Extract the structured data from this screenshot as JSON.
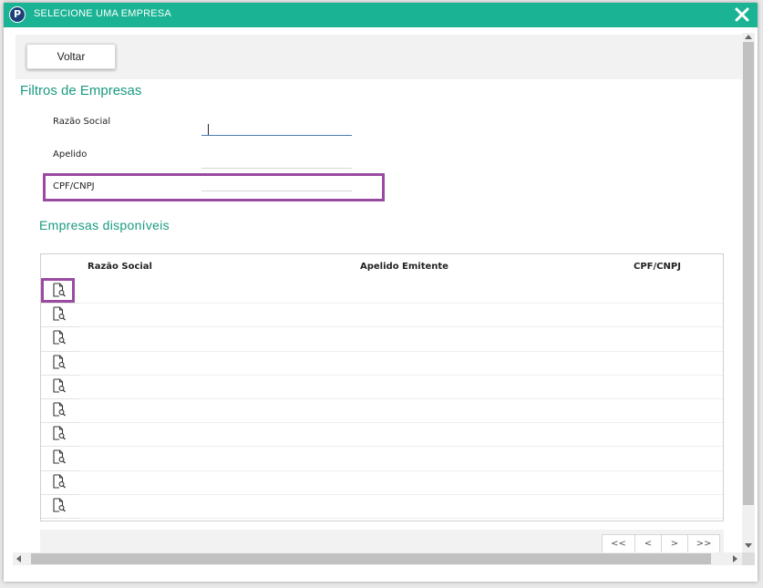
{
  "window": {
    "title": "SELECIONE UMA EMPRESA",
    "icon_letter": "P",
    "accent_color": "#1ab394",
    "highlight_color": "#9b4aa2"
  },
  "toolbar": {
    "back_label": "Voltar"
  },
  "filters": {
    "title": "Filtros de Empresas",
    "razao_social_label": "Razão Social",
    "razao_social_value": "",
    "apelido_label": "Apelido",
    "apelido_value": "",
    "cpf_cnpj_label": "CPF/CNPJ",
    "cpf_cnpj_value": ""
  },
  "companies": {
    "title": "Empresas disponíveis",
    "columns": [
      "Razão Social",
      "Apelido Emitente",
      "CPF/CNPJ"
    ],
    "rows": [
      {
        "razao_social": "",
        "apelido": "",
        "cpf_cnpj": "",
        "icon": "view-document-icon"
      },
      {
        "razao_social": "",
        "apelido": "",
        "cpf_cnpj": "",
        "icon": "view-document-icon"
      },
      {
        "razao_social": "",
        "apelido": "",
        "cpf_cnpj": "",
        "icon": "view-document-icon"
      },
      {
        "razao_social": "",
        "apelido": "",
        "cpf_cnpj": "",
        "icon": "view-document-icon"
      },
      {
        "razao_social": "",
        "apelido": "",
        "cpf_cnpj": "",
        "icon": "view-document-icon"
      },
      {
        "razao_social": "",
        "apelido": "",
        "cpf_cnpj": "",
        "icon": "view-document-icon"
      },
      {
        "razao_social": "",
        "apelido": "",
        "cpf_cnpj": "",
        "icon": "view-document-icon"
      },
      {
        "razao_social": "",
        "apelido": "",
        "cpf_cnpj": "",
        "icon": "view-document-icon"
      },
      {
        "razao_social": "",
        "apelido": "",
        "cpf_cnpj": "",
        "icon": "view-document-icon"
      },
      {
        "razao_social": "",
        "apelido": "",
        "cpf_cnpj": "",
        "icon": "view-document-icon"
      }
    ]
  },
  "pager": {
    "first": "<<",
    "prev": "<",
    "next": ">",
    "last": ">>"
  }
}
